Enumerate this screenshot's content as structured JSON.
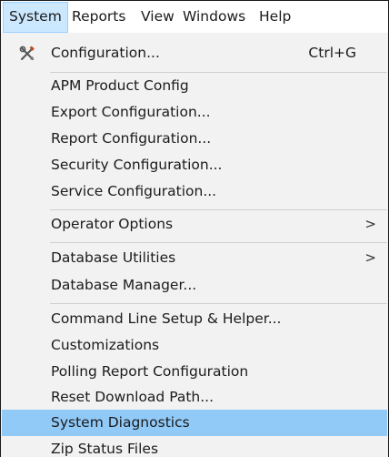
{
  "menubar": {
    "items": [
      "System",
      "Reports",
      "View",
      "Windows",
      "Help"
    ]
  },
  "menu": {
    "configuration": {
      "label": "Configuration...",
      "shortcut": "Ctrl+G",
      "icon": "tools-icon"
    },
    "apm_product_config": "APM Product Config",
    "export_configuration": "Export Configuration...",
    "report_configuration": "Report Configuration...",
    "security_configuration": "Security Configuration...",
    "service_configuration": "Service Configuration...",
    "operator_options": {
      "label": "Operator Options",
      "arrow": ">"
    },
    "database_utilities": {
      "label": "Database Utilities",
      "arrow": ">"
    },
    "database_manager": "Database Manager...",
    "command_line_setup": "Command Line Setup & Helper...",
    "customizations": "Customizations",
    "polling_report_configuration": "Polling Report Configuration",
    "reset_download_path": "Reset Download Path...",
    "system_diagnostics": "System Diagnostics",
    "zip_status_files": "Zip Status Files"
  },
  "colors": {
    "highlight": "#91c9f7",
    "menubar_active": "#cce8ff",
    "menu_background": "#f2f2f2"
  }
}
